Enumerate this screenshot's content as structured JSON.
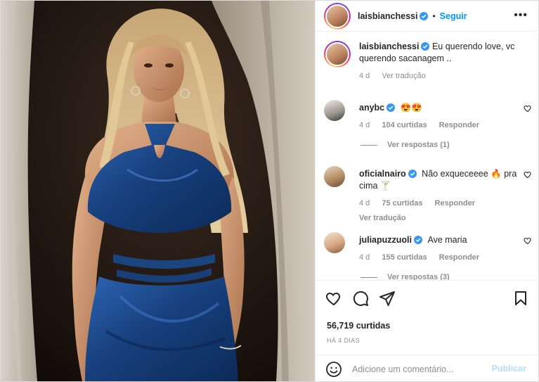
{
  "post": {
    "author": "laisbianchessi",
    "follow_label": "Seguir",
    "dot": "•",
    "more_label": "•••",
    "caption_text": "Eu querendo love, vc querendo sacanagem ..",
    "caption_age": "4 d",
    "caption_translate": "Ver tradução"
  },
  "comments": [
    {
      "user": "anybc",
      "text": "😍😍",
      "age": "4 d",
      "likes": "104 curtidas",
      "reply_label": "Responder",
      "view_replies": "Ver respostas (1)"
    },
    {
      "user": "oficialnairo",
      "text": "Não exqueceeee 🔥 pra cima 🍸",
      "age": "4 d",
      "likes": "75 curtidas",
      "reply_label": "Responder",
      "translate": "Ver tradução"
    },
    {
      "user": "juliapuzzuoli",
      "text": "Ave maria",
      "age": "4 d",
      "likes": "155 curtidas",
      "reply_label": "Responder",
      "view_replies": "Ver respostas (3)"
    }
  ],
  "actions": {
    "likes_count": "56,719 curtidas",
    "date_label": "HÁ 4 DIAS",
    "icons": [
      "heart-icon",
      "comment-icon",
      "share-icon",
      "bookmark-icon"
    ]
  },
  "composer": {
    "placeholder": "Adicione um comentário...",
    "publish_label": "Publicar"
  },
  "colors": {
    "accent": "#0095f6",
    "verified": "#3897f0",
    "muted": "#8e8e8e",
    "publish_disabled": "#b2dffc",
    "dress": "#1e4a8a"
  }
}
